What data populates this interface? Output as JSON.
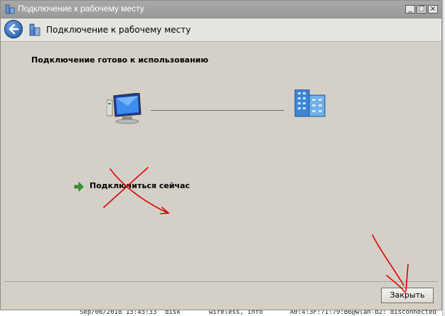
{
  "window": {
    "title": "Подключение к рабочему месту",
    "controls": {
      "minimize": "_",
      "maximize": "□",
      "close": "×"
    }
  },
  "navbar": {
    "back_icon": "back-arrow-icon",
    "title_icon": "workplace-network-icon",
    "title": "Подключение к рабочему месту"
  },
  "content": {
    "heading": "Подключение готово к использованию",
    "left_icon": "computer-icon",
    "right_icon": "workplace-server-icon",
    "connect_icon": "green-arrow-icon",
    "connect_label": "Подключиться сейчас"
  },
  "footer": {
    "close_label": "Закрыть"
  },
  "background": {
    "texts": [
      "Sep/06/2018 15:45:33",
      "disk",
      "wireless, info",
      "A0:4:3F:71:79:B6@wlan-b2: disconnected"
    ]
  },
  "annotations": {
    "color": "#e00000",
    "marks": [
      "cross-mark",
      "arrow-mark"
    ]
  },
  "colors": {
    "window_bg": "#d4d0c8",
    "titlebar": "#9f9f9f",
    "back_button": "#2a62b4",
    "arrow_green": "#2f9b2f"
  }
}
